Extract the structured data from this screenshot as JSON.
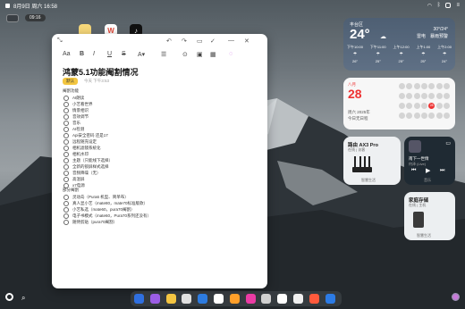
{
  "statusbar": {
    "time": "8月9日 周六 16:58",
    "desktop_time": "09:16"
  },
  "desktop_icons": [
    {
      "name": "notes",
      "glyph": "",
      "color": "#f4d36b"
    },
    {
      "name": "wps",
      "glyph": "W",
      "color": "#e24a3a"
    },
    {
      "name": "tiktok",
      "glyph": "♪",
      "color": "#111111"
    }
  ],
  "note": {
    "title": "鸿蒙5.1功能阉割情况",
    "tag": "默认",
    "meta": "今天 下午3:53",
    "section1": "阉割功能",
    "items1": [
      "AI朗读",
      "小艺看世界",
      "情景相识",
      "音效调节",
      "音乐",
      "AI检测",
      "Api安全密码 还是17",
      "远程随充设定",
      "相机滤镜系统化",
      "相机水印",
      "主题（只能线下选择）",
      "全新的锁屏样式选择",
      "音频降噪（无）",
      "高温屏",
      "x7电源"
    ],
    "section2": "部分阉割",
    "items2": [
      "灵动岛（Pura6  机型、简单布）",
      "真人显小艺（mate80，mate70标准版款）",
      "小艺私选（mate60，pura70阉割）",
      "电子书模式（mate60，Pura70系列还没有）",
      "随侍剪贴（pura70阉割）"
    ]
  },
  "weather": {
    "location": "丰台区",
    "temp": "24°",
    "range": "30°/24°",
    "desc": "雷电　暴雨预警",
    "hours": [
      {
        "t": "下午10:00",
        "v": "26°"
      },
      {
        "t": "下午11:00",
        "v": "25°"
      },
      {
        "t": "上午12:00",
        "v": "25°"
      },
      {
        "t": "上午1:00",
        "v": "25°"
      },
      {
        "t": "上午2:00",
        "v": "24°"
      }
    ]
  },
  "calendar": {
    "month_day": "八月",
    "day": "28",
    "line1": "周六 2025年",
    "line2": "今日无日程",
    "weeks": [
      [
        "",
        "",
        "",
        "",
        "",
        "",
        ""
      ],
      [
        "",
        "",
        "",
        "",
        "",
        "",
        ""
      ],
      [
        "",
        "",
        "",
        "",
        "28",
        "",
        ""
      ],
      [
        "",
        "",
        "",
        "",
        "",
        "",
        ""
      ]
    ]
  },
  "router": {
    "title": "路由 AX3 Pro",
    "sub": "在线 | 访客",
    "footer": "智慧生活"
  },
  "music": {
    "title": "南下一世情",
    "artist": "何泽 (Live)",
    "footer": "音乐"
  },
  "storage": {
    "title": "家庭存储",
    "sub": "在线 | 主机",
    "footer": "智慧生活"
  },
  "dock_apps": [
    "#2f6fe0",
    "#9b5de5",
    "#f4c542",
    "#e0e0e0",
    "#2d7be0",
    "#ffffff",
    "#ff9f2a",
    "#ea3ba4",
    "#d0d0d0",
    "#ffffff",
    "#f0f0f0",
    "#ff5a3c",
    "#2c7be5"
  ]
}
